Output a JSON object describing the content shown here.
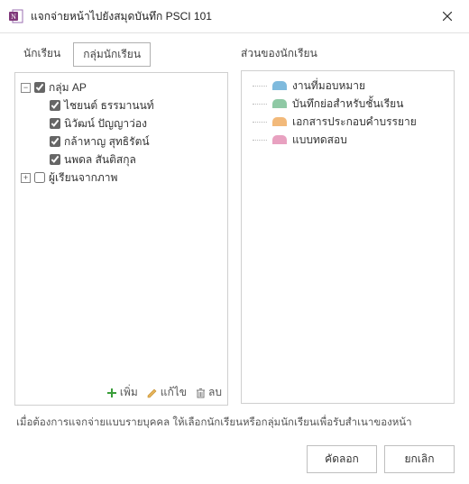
{
  "window": {
    "title": "แจกจ่ายหน้าไปยังสมุดบันทึก PSCI 101"
  },
  "tabs": {
    "students": "นักเรียน",
    "groups": "กลุ่มนักเรียน"
  },
  "right_label": "ส่วนของนักเรียน",
  "tree": {
    "group_ap": {
      "label": "กลุ่ม AP",
      "checked": true,
      "expanded": true
    },
    "students": [
      {
        "name": "ไชยนต์ ธรรมานนท์",
        "checked": true
      },
      {
        "name": "นิวัฒน์ ปัญญาว่อง",
        "checked": true
      },
      {
        "name": "กล้าหาญ สุทธิรัตน์",
        "checked": true
      },
      {
        "name": "นพดล สันติสกุล",
        "checked": true
      }
    ],
    "external": {
      "label": "ผู้เรียนจากภาพ",
      "checked": false,
      "expanded": false
    }
  },
  "sections": [
    {
      "label": "งานที่มอบหมาย",
      "color": "#7fbadd"
    },
    {
      "label": "บันทึกย่อสำหรับชั้นเรียน",
      "color": "#8fc9a5"
    },
    {
      "label": "เอกสารประกอบคำบรรยาย",
      "color": "#f2b97a"
    },
    {
      "label": "แบบทดสอบ",
      "color": "#e8a1c0"
    }
  ],
  "toolbar": {
    "add": "เพิ่ม",
    "edit": "แก้ไข",
    "delete": "ลบ"
  },
  "helper_text": "เมื่อต้องการแจกจ่ายแบบรายบุคคล ให้เลือกนักเรียนหรือกลุ่มนักเรียนเพื่อรับสำเนาของหน้า",
  "buttons": {
    "primary": "คัดลอก",
    "cancel": "ยกเลิก"
  },
  "glyphs": {
    "minus": "−",
    "plus": "+"
  }
}
